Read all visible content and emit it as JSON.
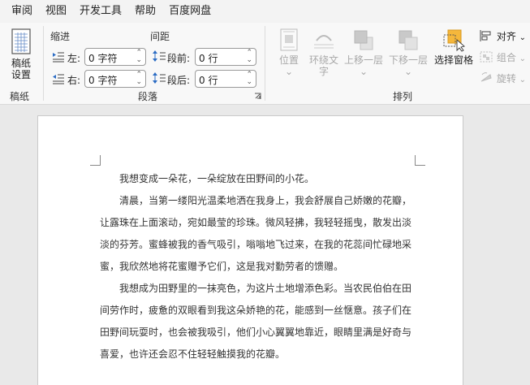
{
  "menu": [
    "审阅",
    "视图",
    "开发工具",
    "帮助",
    "百度网盘"
  ],
  "ribbon": {
    "gaozhi": {
      "button_line1": "稿纸",
      "button_line2": "设置",
      "group": "稿纸"
    },
    "paragraph": {
      "indent_header": "缩进",
      "spacing_header": "间距",
      "left_label": "左:",
      "right_label": "右:",
      "before_label": "段前:",
      "after_label": "段后:",
      "left_value": "0 字符",
      "right_value": "0 字符",
      "before_value": "0 行",
      "after_value": "0 行",
      "group": "段落"
    },
    "arrange": {
      "position": "位置",
      "wrap_line1": "环绕文",
      "wrap_line2": "字",
      "bring_forward": "上移一层",
      "send_backward": "下移一层",
      "selection_pane": "选择窗格",
      "align": "对齐",
      "group_btn": "组合",
      "rotate": "旋转",
      "group": "排列"
    }
  },
  "document": {
    "paragraphs": [
      "我想变成一朵花，一朵绽放在田野间的小花。",
      "清晨，当第一缕阳光温柔地洒在我身上，我会舒展自己娇嫩的花瓣，让露珠在上面滚动，宛如最莹的珍珠。微风轻拂，我轻轻摇曳，散发出淡淡的芬芳。蜜蜂被我的香气吸引，嗡嗡地飞过来，在我的花蕊间忙碌地采蜜，我欣然地将花蜜赠予它们，这是我对勤劳者的馈赠。",
      "我想成为田野里的一抹亮色，为这片土地增添色彩。当农民伯伯在田间劳作时，疲惫的双眼看到我这朵娇艳的花，能感到一丝惬意。孩子们在田野间玩耍时，也会被我吸引，他们小心翼翼地靠近，眼睛里满是好奇与喜爱，也许还会忍不住轻轻触摸我的花瓣。"
    ]
  },
  "colors": {
    "accent": "#f5b73b",
    "disabled": "#a8a8a8"
  }
}
